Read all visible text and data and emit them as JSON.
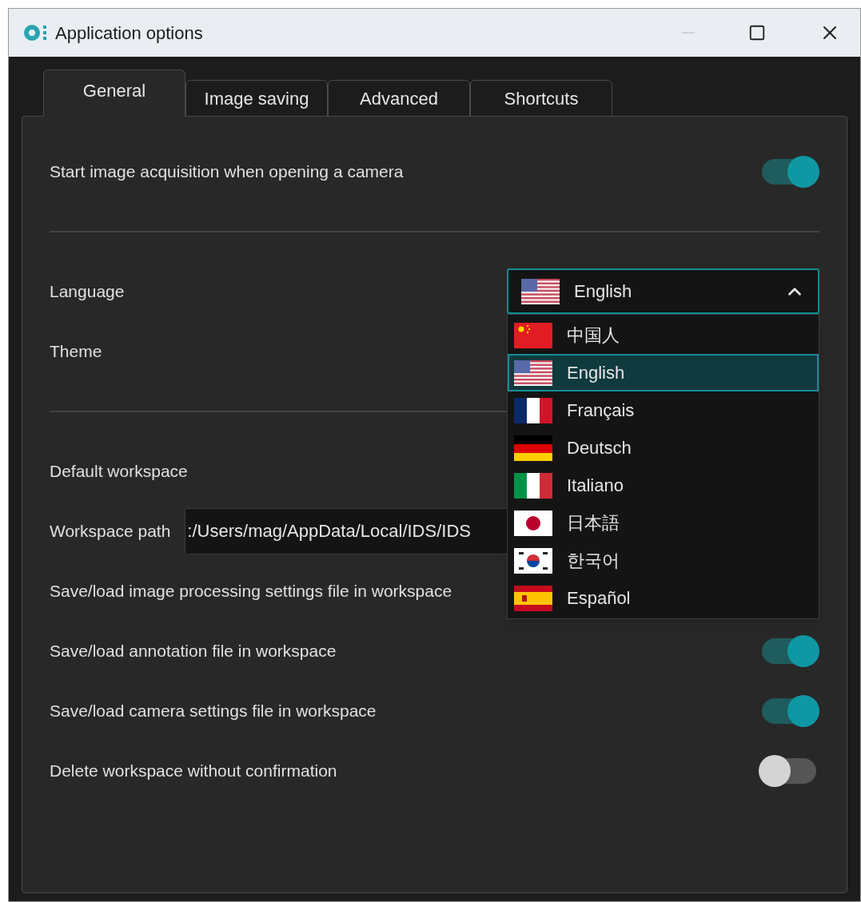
{
  "window": {
    "title": "Application options",
    "minimize_disabled": true
  },
  "tabs": [
    {
      "label": "General",
      "selected": true
    },
    {
      "label": "Image saving",
      "selected": false
    },
    {
      "label": "Advanced",
      "selected": false
    },
    {
      "label": "Shortcuts",
      "selected": false
    }
  ],
  "rows": [
    {
      "kind": "toggle",
      "label": "Start image acquisition when opening a camera",
      "on": true
    },
    {
      "kind": "divider"
    },
    {
      "kind": "language",
      "label": "Language"
    },
    {
      "kind": "plain",
      "label": "Theme"
    },
    {
      "kind": "divider"
    },
    {
      "kind": "plain",
      "label": "Default workspace"
    },
    {
      "kind": "path",
      "label": "Workspace path",
      "value": ":/Users/mag/AppData/Local/IDS/IDS"
    },
    {
      "kind": "plain",
      "label": "Save/load image processing settings file in workspace"
    },
    {
      "kind": "toggle",
      "label": "Save/load annotation file in workspace",
      "on": true
    },
    {
      "kind": "toggle",
      "label": "Save/load camera settings file in workspace",
      "on": true
    },
    {
      "kind": "toggle",
      "label": "Delete workspace without confirmation",
      "on": false
    }
  ],
  "language": {
    "value": "English",
    "kind": "us",
    "expanded": true,
    "options": [
      {
        "label": "中国人",
        "kind": "cn",
        "selected": false
      },
      {
        "label": "English",
        "kind": "us",
        "selected": true
      },
      {
        "label": "Français",
        "kind": "fr",
        "selected": false
      },
      {
        "label": "Deutsch",
        "kind": "de",
        "selected": false
      },
      {
        "label": "Italiano",
        "kind": "it",
        "selected": false
      },
      {
        "label": "日本語",
        "kind": "jp",
        "selected": false
      },
      {
        "label": "한국어",
        "kind": "kr",
        "selected": false
      },
      {
        "label": "Español",
        "kind": "es",
        "selected": false
      }
    ]
  }
}
